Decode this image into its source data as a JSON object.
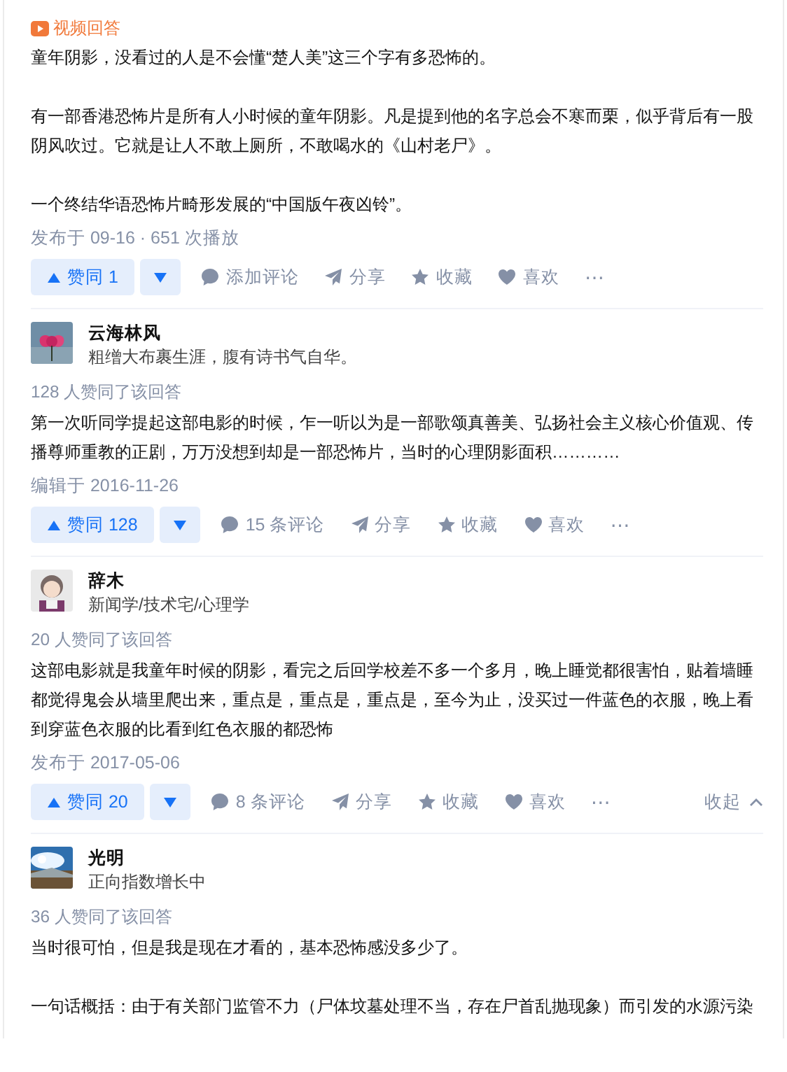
{
  "answers": [
    {
      "tag": {
        "label": "视频回答"
      },
      "paragraphs": [
        "童年阴影，没看过的人是不会懂“楚人美”这三个字有多恐怖的。",
        "有一部香港恐怖片是所有人小时候的童年阴影。凡是提到他的名字总会不寒而栗，似乎背后有一股阴风吹过。它就是让人不敢上厕所，不敢喝水的《山村老尸》。",
        "一个终结华语恐怖片畸形发展的“中国版午夜凶铃”。"
      ],
      "meta": "发布于 09-16 · 651 次播放",
      "actions": {
        "upvote": "赞同 1",
        "comment": "添加评论",
        "share": "分享",
        "collect": "收藏",
        "like": "喜欢",
        "more": "⋯"
      }
    },
    {
      "author": {
        "name": "云海林风",
        "bio": "粗缯大布裹生涯，腹有诗书气自华。"
      },
      "votes": "128 人赞同了该回答",
      "paragraphs": [
        "第一次听同学提起这部电影的时候，乍一听以为是一部歌颂真善美、弘扬社会主义核心价值观、传播尊师重教的正剧，万万没想到却是一部恐怖片，当时的心理阴影面积…………"
      ],
      "meta": "编辑于 2016-11-26",
      "actions": {
        "upvote": "赞同 128",
        "comment": "15 条评论",
        "share": "分享",
        "collect": "收藏",
        "like": "喜欢",
        "more": "⋯"
      }
    },
    {
      "author": {
        "name": "辞木",
        "bio": "新闻学/技术宅/心理学"
      },
      "votes": "20 人赞同了该回答",
      "paragraphs": [
        "这部电影就是我童年时候的阴影，看完之后回学校差不多一个多月，晚上睡觉都很害怕，贴着墙睡都觉得鬼会从墙里爬出来，重点是，重点是，重点是，至今为止，没买过一件蓝色的衣服，晚上看到穿蓝色衣服的比看到红色衣服的都恐怖"
      ],
      "meta": "发布于 2017-05-06",
      "actions": {
        "upvote": "赞同 20",
        "comment": "8 条评论",
        "share": "分享",
        "collect": "收藏",
        "like": "喜欢",
        "more": "⋯",
        "collapse": "收起"
      }
    },
    {
      "author": {
        "name": "光明",
        "bio": "正向指数增长中"
      },
      "votes": "36 人赞同了该回答",
      "paragraphs": [
        "当时很可怕，但是我是现在才看的，基本恐怖感没多少了。",
        "一句话概括：由于有关部门监管不力（尸体坟墓处理不当，存在尸首乱抛现象）而引发的水源污染"
      ]
    }
  ]
}
